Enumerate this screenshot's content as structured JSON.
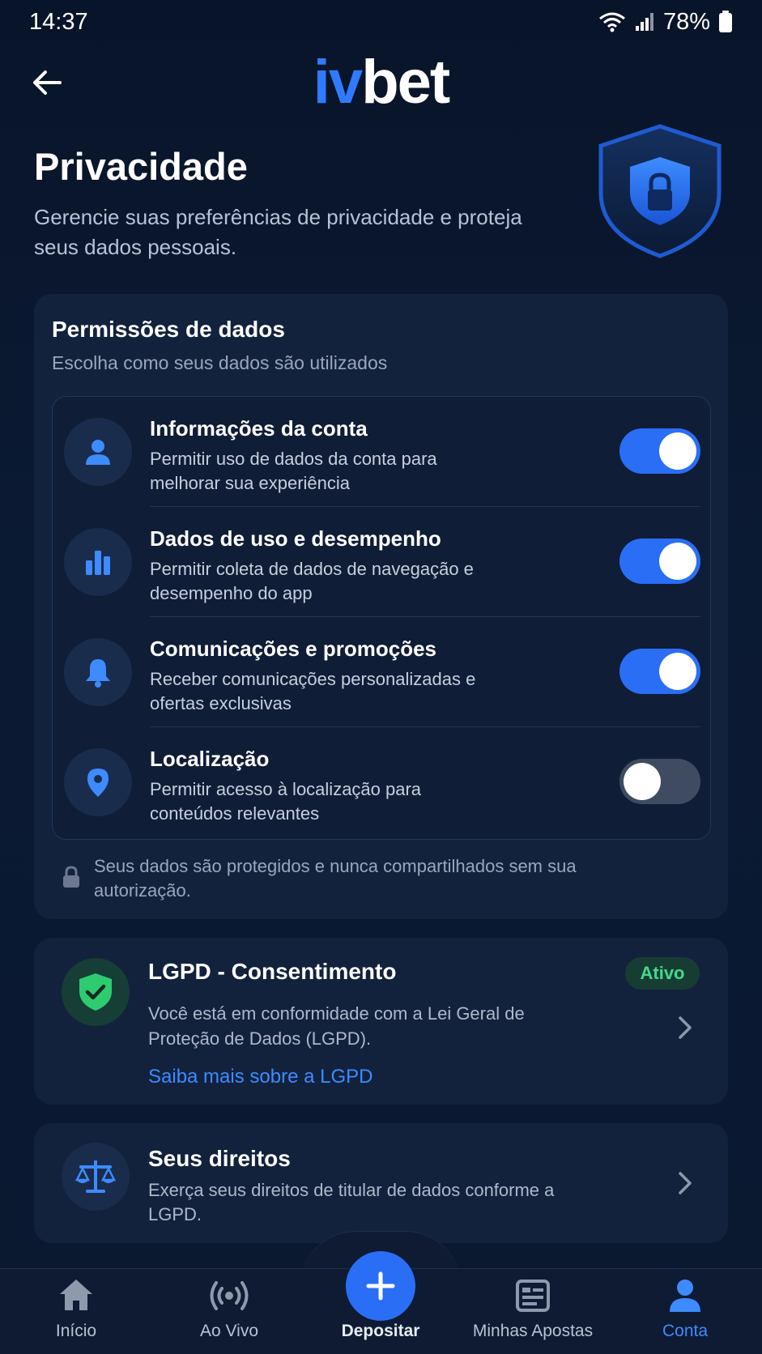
{
  "status_bar": {
    "time": "14:37",
    "battery": "78%"
  },
  "header": {
    "logo_part1": "iv",
    "logo_part2": "bet"
  },
  "page": {
    "title": "Privacidade",
    "subtitle": "Gerencie suas preferências de privacidade e proteja seus dados pessoais."
  },
  "permissions": {
    "title": "Permissões de dados",
    "subtitle": "Escolha como seus dados são utilizados",
    "items": [
      {
        "title": "Informações da conta",
        "desc": "Permitir uso de dados da conta para melhorar sua experiência",
        "enabled": true,
        "icon": "user-icon"
      },
      {
        "title": "Dados de uso e desempenho",
        "desc": "Permitir coleta de dados de navegação e desempenho do app",
        "enabled": true,
        "icon": "bar-chart-icon"
      },
      {
        "title": "Comunicações e promoções",
        "desc": "Receber comunicações personalizadas e ofertas exclusivas",
        "enabled": true,
        "icon": "bell-icon"
      },
      {
        "title": "Localização",
        "desc": "Permitir acesso à localização para conteúdos relevantes",
        "enabled": false,
        "icon": "location-pin-icon"
      }
    ],
    "note": "Seus dados são protegidos e nunca compartilhados sem sua autorização."
  },
  "lgpd": {
    "title": "LGPD - Consentimento",
    "badge": "Ativo",
    "desc": "Você está em conformidade com a Lei Geral de Proteção de Dados (LGPD).",
    "link": "Saiba mais sobre a LGPD"
  },
  "rights": {
    "title": "Seus direitos",
    "desc": "Exerça seus direitos de titular de dados conforme a LGPD."
  },
  "bottom_nav": {
    "items": [
      "Início",
      "Ao Vivo",
      "Depositar",
      "Minhas Apostas",
      "Conta"
    ],
    "active": "Conta"
  },
  "colors": {
    "accent": "#2a6ef6",
    "link": "#3d8bff",
    "success": "#45d88d",
    "background": "#0a1830"
  }
}
